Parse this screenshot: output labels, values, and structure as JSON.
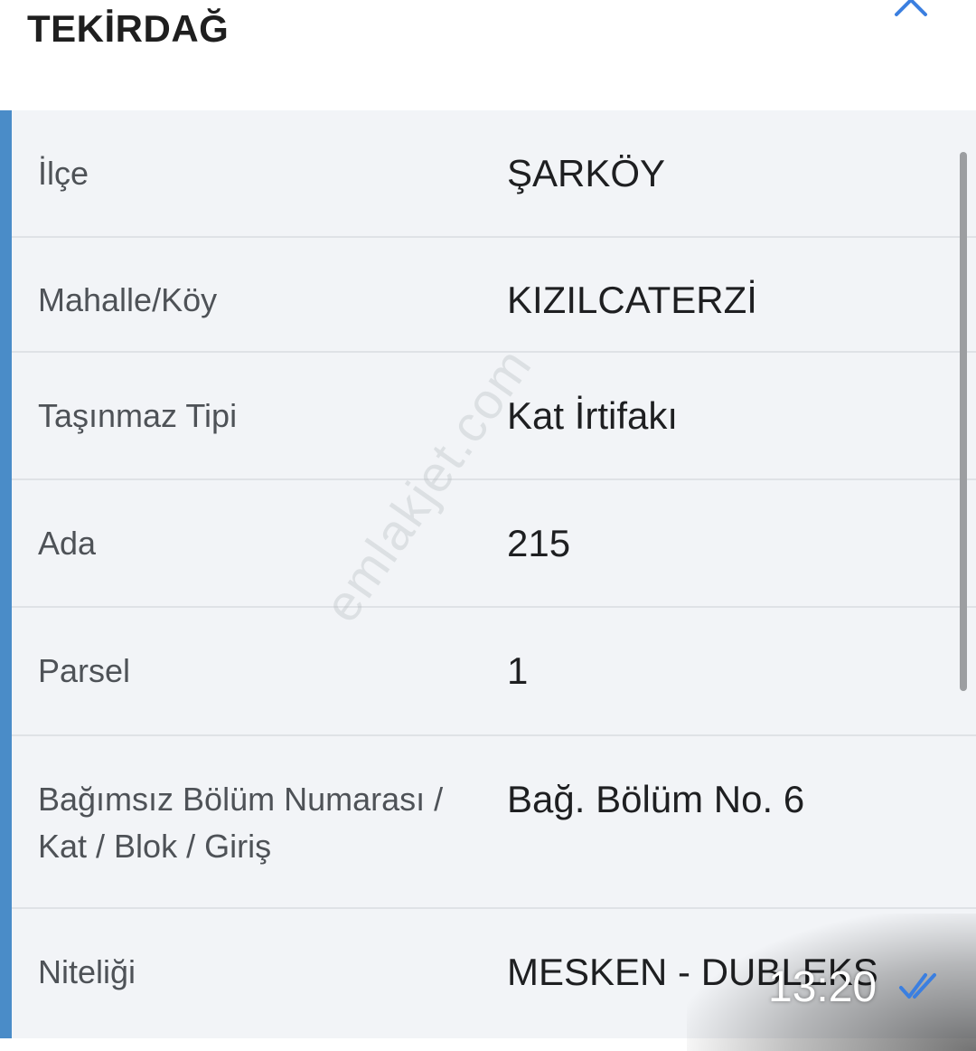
{
  "header": {
    "title": "TEKİRDAĞ"
  },
  "rows": [
    {
      "label": "İlçe",
      "value": "ŞARKÖY"
    },
    {
      "label": "Mahalle/Köy",
      "value": "KIZILCATERZİ"
    },
    {
      "label": "Taşınmaz Tipi",
      "value": "Kat İrtifakı"
    },
    {
      "label": "Ada",
      "value": "215"
    },
    {
      "label": "Parsel",
      "value": "1"
    },
    {
      "label": "Bağımsız Bölüm Numarası / Kat / Blok / Giriş",
      "value": "Bağ. Bölüm No. 6"
    },
    {
      "label": "Niteliği",
      "value": "MESKEN - DUBLEKS"
    }
  ],
  "watermark": "emlakjet.com",
  "message_overlay": {
    "time": "13:20",
    "status_icon": "double-check-icon"
  },
  "colors": {
    "accent": "#4a8cc8",
    "row_background": "#f2f4f7",
    "read_ticks": "#3b7fe0"
  }
}
